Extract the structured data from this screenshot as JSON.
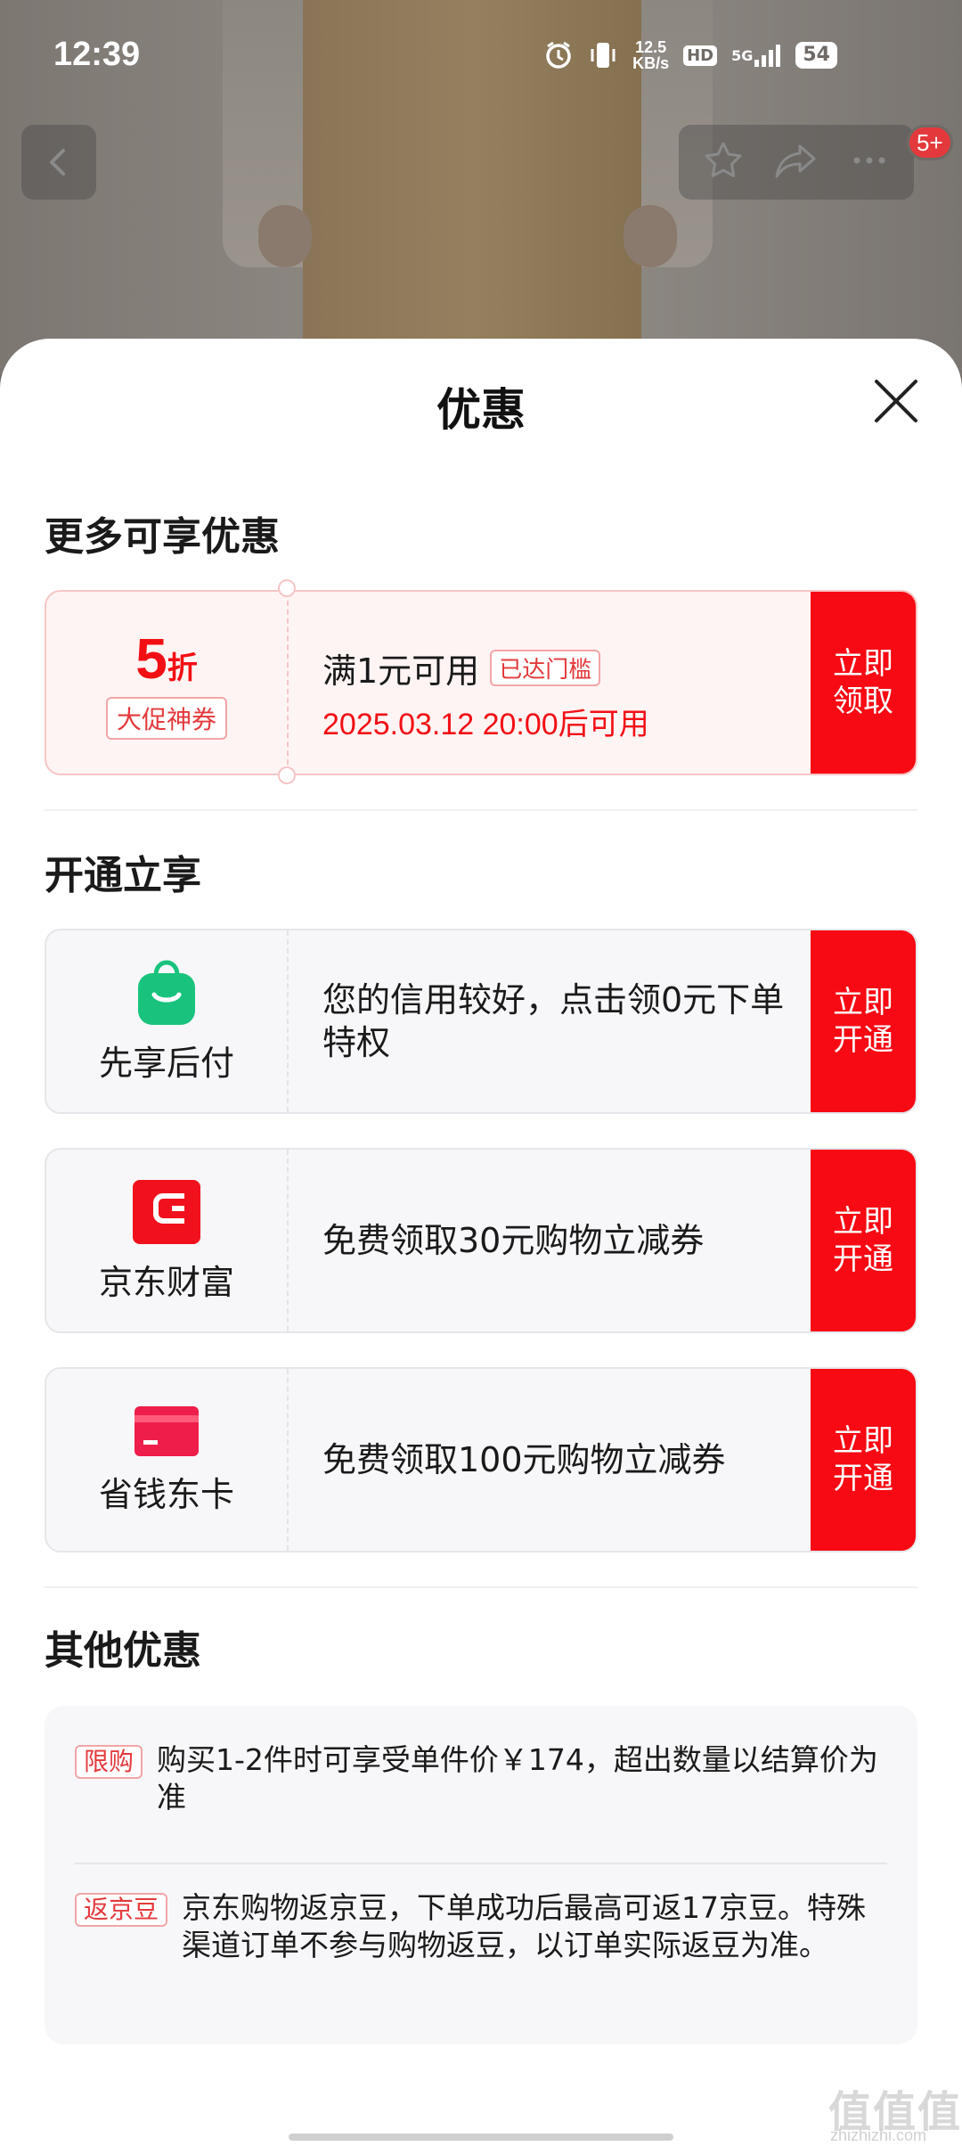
{
  "status_bar": {
    "time": "12:39",
    "net_speed_value": "12.5",
    "net_speed_unit": "KB/s",
    "hd_label": "HD",
    "network_label": "5G",
    "battery": "54"
  },
  "nav": {
    "badge": "5+"
  },
  "sheet": {
    "title": "优惠"
  },
  "section_more": {
    "title": "更多可享优惠",
    "coupon": {
      "discount_number": "5",
      "discount_unit": "折",
      "tag": "大促神券",
      "condition": "满1元可用",
      "condition_badge": "已达门槛",
      "time": "2025.03.12 20:00后可用",
      "button": "立即领取"
    }
  },
  "section_open": {
    "title": "开通立享",
    "items": [
      {
        "name": "先享后付",
        "desc": "您的信用较好，点击领0元下单特权",
        "button": "立即开通",
        "icon": "shopping-bag-icon"
      },
      {
        "name": "京东财富",
        "desc": "免费领取30元购物立减券",
        "button": "立即开通",
        "icon": "wallet-icon"
      },
      {
        "name": "省钱东卡",
        "desc": "免费领取100元购物立减券",
        "button": "立即开通",
        "icon": "card-icon"
      }
    ]
  },
  "section_other": {
    "title": "其他优惠",
    "items": [
      {
        "tag": "限购",
        "text": "购买1-2件时可享受单件价￥174，超出数量以结算价为准"
      },
      {
        "tag": "返京豆",
        "text": "京东购物返京豆，下单成功后最高可返17京豆。特殊渠道订单不参与购物返豆，以订单实际返豆为准。"
      }
    ]
  },
  "watermark": {
    "main": "值值值",
    "sub": "zhizhizhi.com"
  },
  "colors": {
    "accent_red": "#f70a13",
    "coupon_bg": "#fff4f4",
    "green_icon": "#19c37d"
  }
}
